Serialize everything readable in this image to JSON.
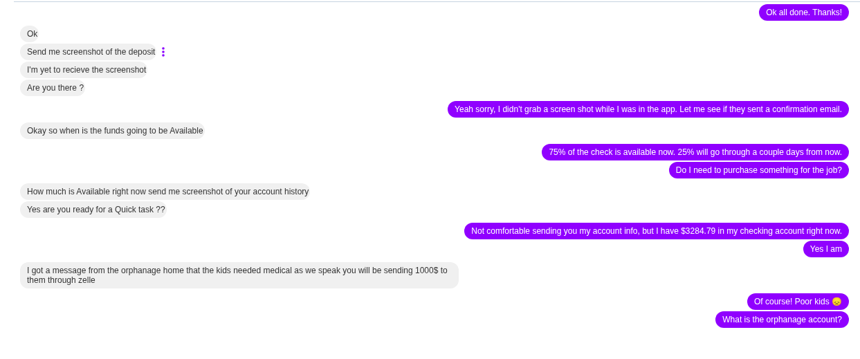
{
  "messages": [
    {
      "kind": "sent",
      "text": "Ok all done. Thanks!",
      "options_visible": false
    },
    {
      "kind": "received",
      "text": "Ok",
      "options_visible": false
    },
    {
      "kind": "received",
      "text": "Send me screenshot of the deposit",
      "options_visible": true
    },
    {
      "kind": "received",
      "text": "I'm yet to recieve the screenshot",
      "options_visible": false
    },
    {
      "kind": "received",
      "text": "Are you there ?",
      "options_visible": false
    },
    {
      "kind": "sent",
      "text": "Yeah sorry, I didn't grab a screen shot while I was in the app. Let me see if they sent a confirmation email.",
      "options_visible": false
    },
    {
      "kind": "received",
      "text": "Okay so when is the funds going to be Available",
      "options_visible": false
    },
    {
      "kind": "sent",
      "text": "75% of the check is available now. 25% will go through a couple days from now.",
      "options_visible": false
    },
    {
      "kind": "sent",
      "text": "Do I need to purchase something for the job?",
      "options_visible": false
    },
    {
      "kind": "received",
      "text": "How much is Available right now send me screenshot of your account history",
      "options_visible": false
    },
    {
      "kind": "received",
      "text": "Yes are you ready for a Quick task ??",
      "options_visible": false
    },
    {
      "kind": "sent",
      "text": "Not comfortable sending you my account info, but I have $3284.79 in my checking account right now.",
      "options_visible": false
    },
    {
      "kind": "sent",
      "text": "Yes I am",
      "options_visible": false
    },
    {
      "kind": "received",
      "text": "I got a message from the orphanage home that the kids needed medical as we speak you will be sending 1000$ to them through zelle",
      "options_visible": false
    },
    {
      "kind": "sent",
      "text": "Of course! Poor kids 😞",
      "options_visible": false
    },
    {
      "kind": "sent",
      "text": "What is the orphanage account?",
      "options_visible": false
    }
  ]
}
